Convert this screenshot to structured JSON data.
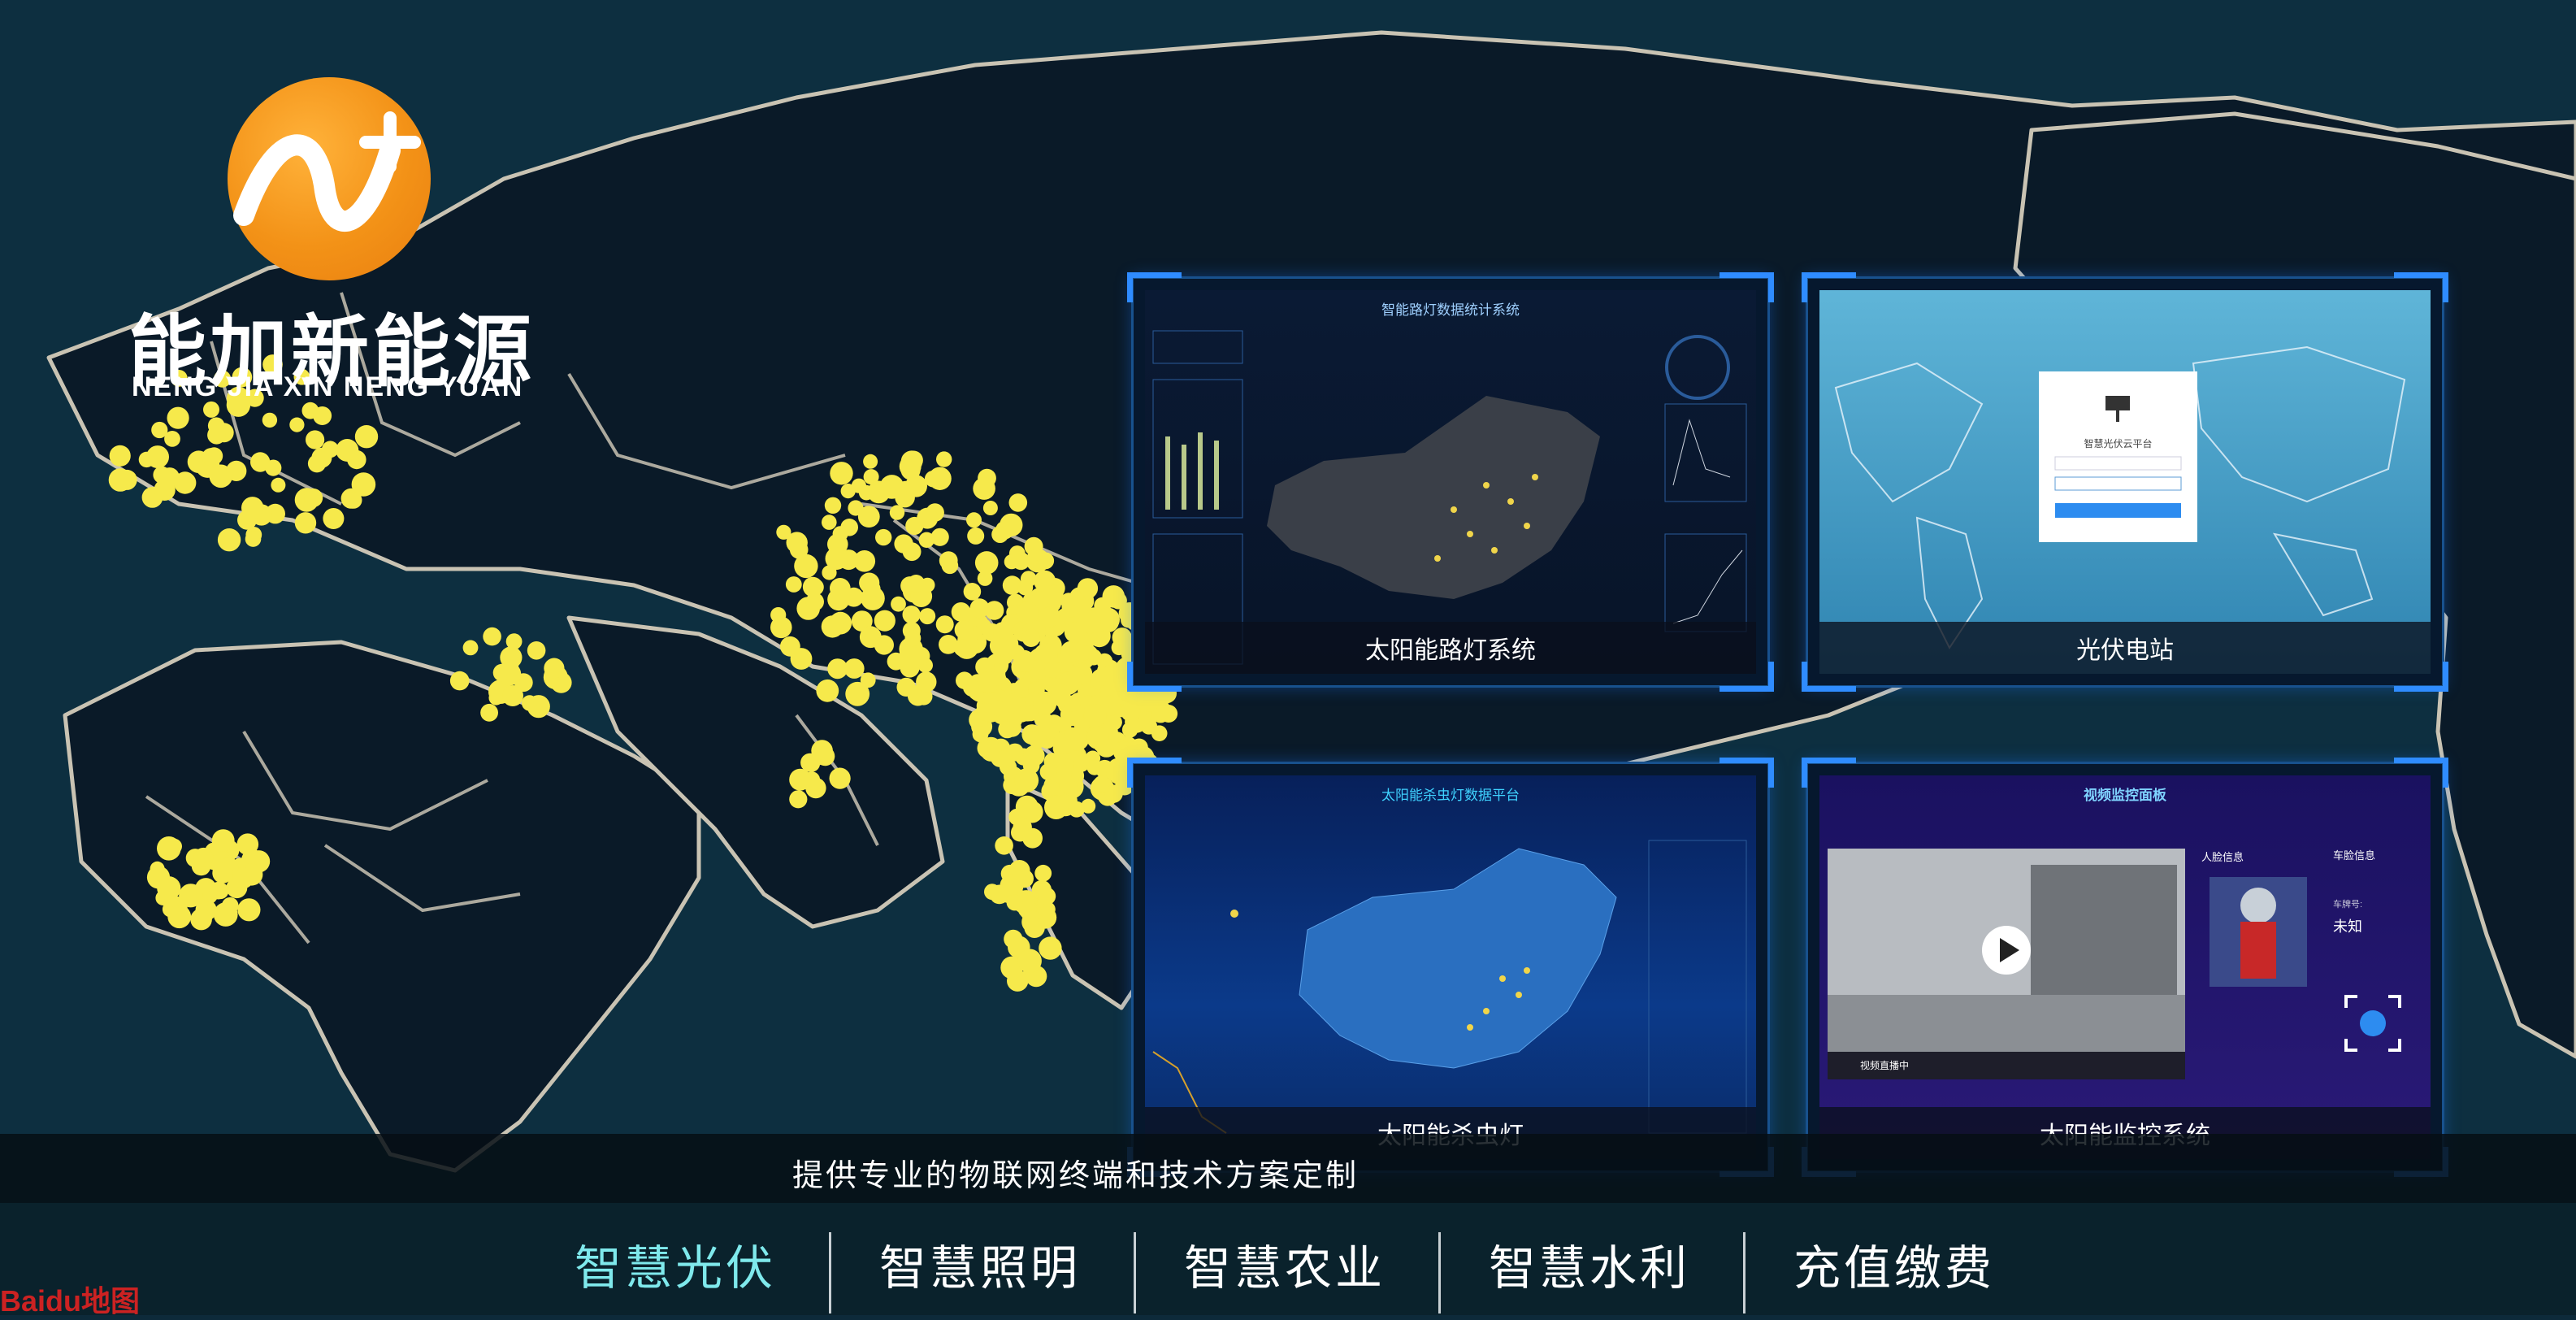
{
  "brand": {
    "name": "能加新能源",
    "subtitle": "NENG JIA XIN NENG YUAN",
    "colors": {
      "primary": "#f39217",
      "accent": "#7fe9ec",
      "card_border": "#2f8cff",
      "map_dot": "#f6e94b"
    }
  },
  "cards": [
    {
      "caption": "太阳能路灯系统",
      "screen_title": "智能路灯数据统计系统"
    },
    {
      "caption": "光伏电站",
      "screen_title": "智慧光伏云平台"
    },
    {
      "caption": "太阳能杀虫灯",
      "screen_title": "太阳能杀虫灯数据平台"
    },
    {
      "caption": "太阳能监控系统",
      "screen_title": "视频监控面板",
      "person_panel": "人脸信息",
      "vehicle_panel": "车脸信息",
      "plate_label": "车牌号:",
      "plate_value": "未知",
      "player_status": "视频直播中"
    }
  ],
  "banner": {
    "text": "提供专业的物联网终端和技术方案定制"
  },
  "nav": {
    "items": [
      {
        "label": "智慧光伏",
        "active": true
      },
      {
        "label": "智慧照明",
        "active": false
      },
      {
        "label": "智慧农业",
        "active": false
      },
      {
        "label": "智慧水利",
        "active": false
      },
      {
        "label": "充值缴费",
        "active": false
      }
    ]
  },
  "map_attribution": "Baidu地图"
}
